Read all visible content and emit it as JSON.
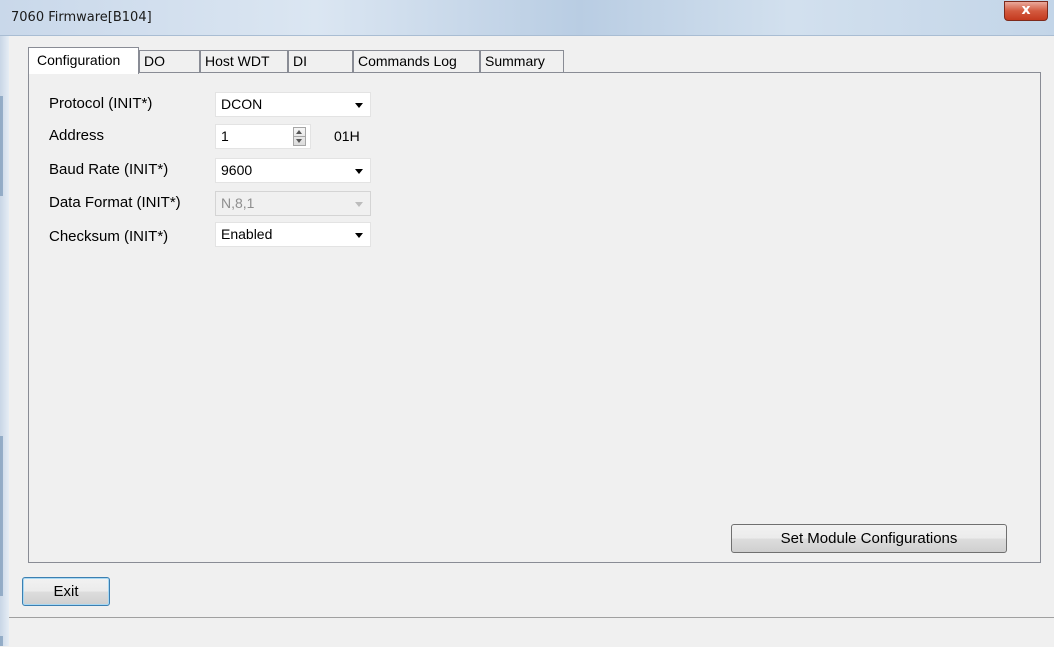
{
  "window": {
    "title": "7060 Firmware[B104]",
    "close_glyph": "x"
  },
  "tabs": [
    {
      "label": "Configuration"
    },
    {
      "label": "DO"
    },
    {
      "label": "Host WDT"
    },
    {
      "label": "DI"
    },
    {
      "label": "Commands Log"
    },
    {
      "label": "Summary"
    }
  ],
  "config": {
    "protocol": {
      "label": "Protocol (INIT*)",
      "value": "DCON"
    },
    "address": {
      "label": "Address",
      "value": "1",
      "hex": "01H"
    },
    "baud_rate": {
      "label": "Baud Rate (INIT*)",
      "value": "9600"
    },
    "data_format": {
      "label": "Data Format (INIT*)",
      "value": "N,8,1"
    },
    "checksum": {
      "label": "Checksum (INIT*)",
      "value": "Enabled"
    },
    "set_button": "Set Module Configurations"
  },
  "exit_button": "Exit",
  "colors": {
    "close_button": "#c43a1f",
    "focus_border": "#3c7fb1"
  }
}
